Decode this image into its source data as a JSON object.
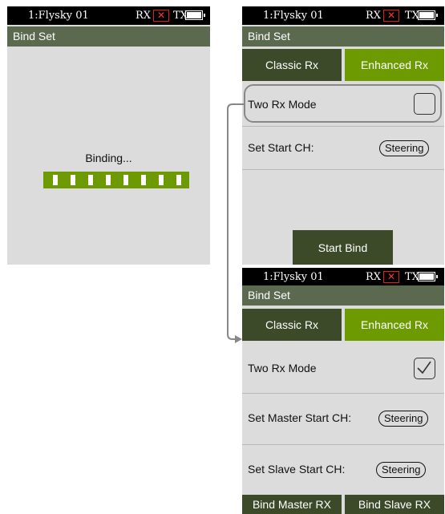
{
  "left_screen": {
    "status": {
      "title": "1:Flysky 01",
      "rx": "RX",
      "rx_error": "✕",
      "tx": "TX"
    },
    "header": "Bind Set",
    "binding_text": "Binding...",
    "progress_segments": 8
  },
  "top_right_screen": {
    "status": {
      "title": "1:Flysky 01",
      "rx": "RX",
      "rx_error": "✕",
      "tx": "TX"
    },
    "header": "Bind Set",
    "tabs": {
      "classic": "Classic Rx",
      "enhanced": "Enhanced Rx"
    },
    "two_rx_mode": {
      "label": "Two Rx Mode",
      "checked": false
    },
    "set_start_ch": {
      "label": "Set Start CH:",
      "value": "Steering"
    },
    "start_bind": "Start Bind"
  },
  "bottom_right_screen": {
    "status": {
      "title": "1:Flysky 01",
      "rx": "RX",
      "rx_error": "✕",
      "tx": "TX"
    },
    "header": "Bind Set",
    "tabs": {
      "classic": "Classic Rx",
      "enhanced": "Enhanced Rx"
    },
    "two_rx_mode": {
      "label": "Two Rx Mode",
      "checked": true
    },
    "set_master_start_ch": {
      "label": "Set Master Start CH:",
      "value": "Steering"
    },
    "set_slave_start_ch": {
      "label": "Set Slave Start CH:",
      "value": "Steering"
    },
    "bind_master_rx": "Bind Master RX",
    "bind_slave_rx": "Bind Slave RX"
  },
  "colors": {
    "header_bg": "#5b6a4e",
    "classic_tab_bg": "#3c4a2a",
    "enhanced_tab_bg": "#6c9a00",
    "screen_bg": "#dcdcdc",
    "arrow": "#888888"
  }
}
